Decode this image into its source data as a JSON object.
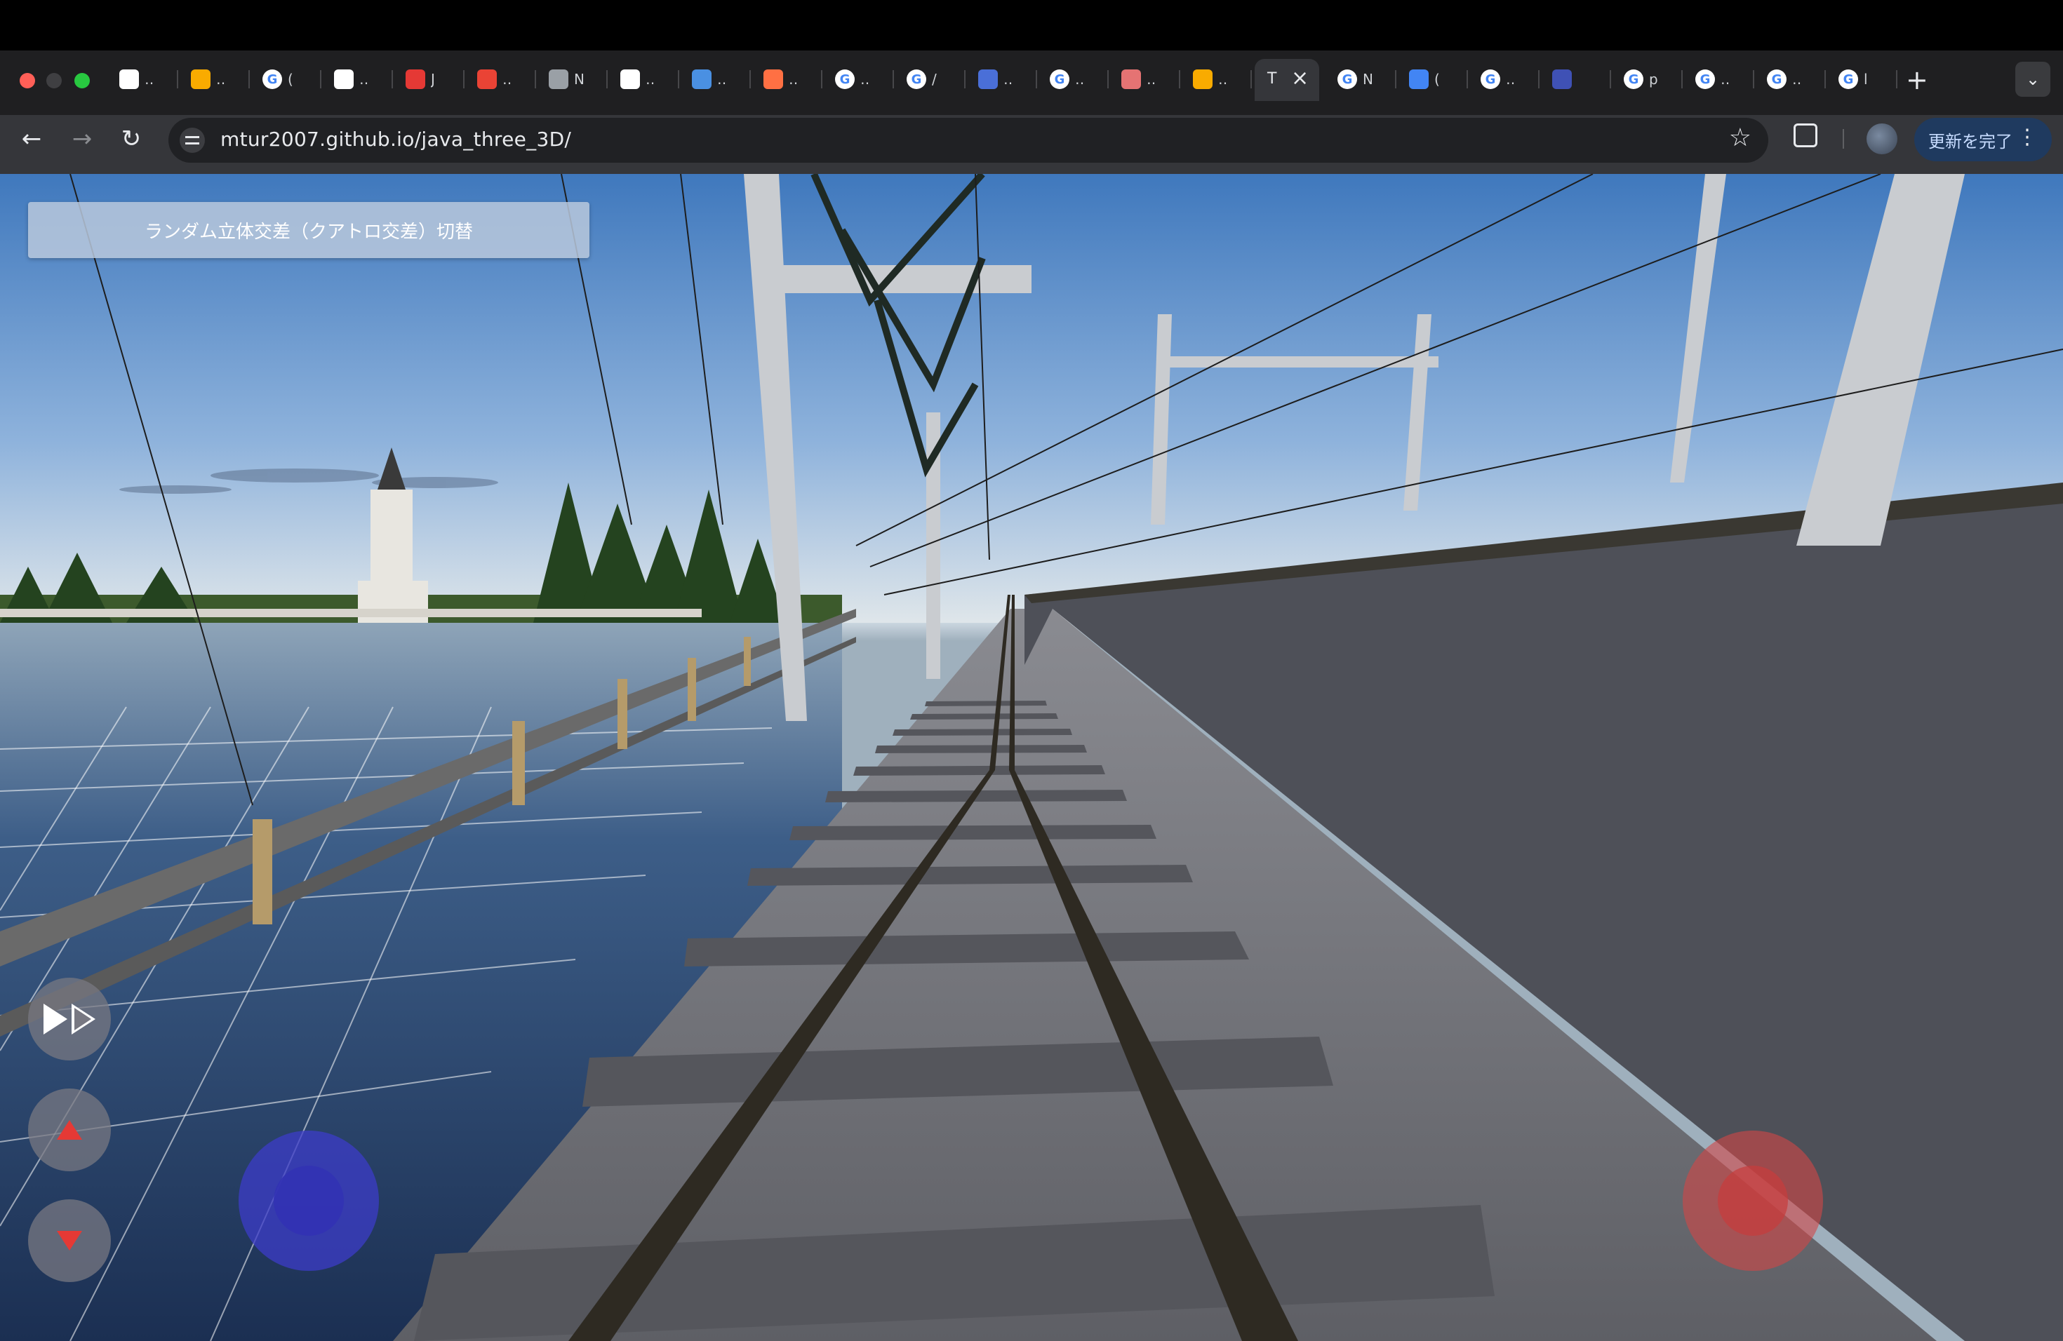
{
  "browser": {
    "tabs": [
      {
        "icon": "openai-icon",
        "label": "…",
        "color": "#ffffff"
      },
      {
        "icon": "analytics-icon",
        "label": "…",
        "color": "#f9ab00"
      },
      {
        "icon": "google-icon",
        "label": "(",
        "color": "#ffffff"
      },
      {
        "icon": "openai-icon",
        "label": "…",
        "color": "#ffffff"
      },
      {
        "icon": "brand-red-icon",
        "label": "J",
        "color": "#e53935"
      },
      {
        "icon": "gmail-icon",
        "label": "…",
        "color": "#ea4335"
      },
      {
        "icon": "globe-icon",
        "label": "N",
        "color": "#9aa0a6"
      },
      {
        "icon": "openai-icon",
        "label": "…",
        "color": "#ffffff"
      },
      {
        "icon": "slash-icon",
        "label": "…",
        "color": "#4a90e2"
      },
      {
        "icon": "puzzle-image-icon",
        "label": "…",
        "color": "#ff7043"
      },
      {
        "icon": "google-icon",
        "label": "…",
        "color": "#ffffff"
      },
      {
        "icon": "google-icon",
        "label": "/",
        "color": "#ffffff"
      },
      {
        "icon": "swirl-icon",
        "label": "…",
        "color": "#4a6fd8"
      },
      {
        "icon": "google-icon",
        "label": "…",
        "color": "#ffffff"
      },
      {
        "icon": "mosaic-icon",
        "label": "…",
        "color": "#e57373"
      },
      {
        "icon": "analytics-icon",
        "label": "…",
        "color": "#f9ab00"
      },
      {
        "icon": "active-page-icon",
        "label": "T",
        "active": true
      },
      {
        "icon": "google-icon",
        "label": "N",
        "color": "#ffffff"
      },
      {
        "icon": "translate-icon",
        "label": "(",
        "color": "#4285f4"
      },
      {
        "icon": "google-icon",
        "label": "…",
        "color": "#ffffff"
      },
      {
        "icon": "kanji-icon",
        "label": "",
        "color": "#3f51b5"
      },
      {
        "icon": "google-icon",
        "label": "p",
        "color": "#ffffff"
      },
      {
        "icon": "google-icon",
        "label": "…",
        "color": "#ffffff"
      },
      {
        "icon": "google-icon",
        "label": "…",
        "color": "#ffffff"
      },
      {
        "icon": "google-icon",
        "label": "l",
        "color": "#ffffff"
      }
    ],
    "active_tab_label": "T",
    "url": "mtur2007.github.io/java_three_3D/",
    "update_label": "更新を完了"
  },
  "scene": {
    "switch_button_label": "ランダム立体交差（クアトロ交差）切替",
    "play_icon": "play-step-icon",
    "up_icon": "arrow-up-icon",
    "down_icon": "arrow-down-icon",
    "colors": {
      "track_bed": "#6b6c72",
      "right_wall": "#4e5058",
      "sleeper": "#55565c",
      "rail": "#2e2a22",
      "water": "#2c4a74",
      "truss": "#c9ccd0",
      "joystick_left": "#3c3cc8",
      "joystick_right": "#d24646"
    }
  }
}
